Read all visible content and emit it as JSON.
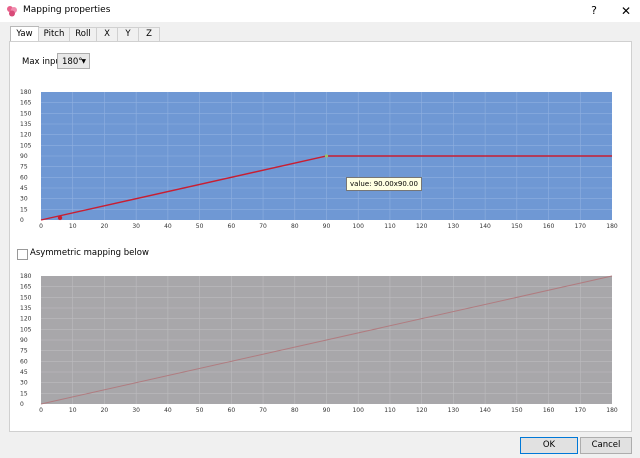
{
  "window": {
    "title": "Mapping properties",
    "help_label": "?",
    "close_label": "✕",
    "icon": "app-logo-icon"
  },
  "tabs": [
    {
      "label": "Yaw",
      "active": true
    },
    {
      "label": "Pitch"
    },
    {
      "label": "Roll"
    },
    {
      "label": "X"
    },
    {
      "label": "Y"
    },
    {
      "label": "Z"
    }
  ],
  "max_input": {
    "label": "Max input",
    "value": "180°"
  },
  "asymmetric": {
    "label": "Asymmetric mapping below",
    "checked": false
  },
  "tooltip": "value: 90.00x90.00",
  "buttons": {
    "ok": "OK",
    "cancel": "Cancel"
  },
  "colors": {
    "top_bg": "#6f98d4",
    "bottom_bg": "#a8a7aa",
    "top_line": "#c81e32",
    "bottom_line": "#b07c80"
  },
  "chart_data": [
    {
      "type": "line",
      "x_ticks": [
        0,
        10,
        20,
        30,
        40,
        50,
        60,
        70,
        80,
        90,
        100,
        110,
        120,
        130,
        140,
        150,
        160,
        170,
        180
      ],
      "y_ticks": [
        0,
        15,
        30,
        45,
        60,
        75,
        90,
        105,
        120,
        135,
        150,
        165,
        180
      ],
      "xlim": [
        0,
        180
      ],
      "ylim": [
        0,
        180
      ],
      "grid": true,
      "series": [
        {
          "points": [
            [
              0,
              0
            ],
            [
              90,
              90
            ],
            [
              180,
              90
            ]
          ]
        }
      ],
      "markers": [
        [
          6,
          3
        ],
        [
          90,
          90
        ]
      ]
    },
    {
      "type": "line",
      "x_ticks": [
        0,
        10,
        20,
        30,
        40,
        50,
        60,
        70,
        80,
        90,
        100,
        110,
        120,
        130,
        140,
        150,
        160,
        170,
        180
      ],
      "y_ticks": [
        0,
        15,
        30,
        45,
        60,
        75,
        90,
        105,
        120,
        135,
        150,
        165,
        180
      ],
      "xlim": [
        0,
        180
      ],
      "ylim": [
        0,
        180
      ],
      "grid": true,
      "series": [
        {
          "points": [
            [
              0,
              0
            ],
            [
              180,
              180
            ]
          ]
        }
      ]
    }
  ]
}
